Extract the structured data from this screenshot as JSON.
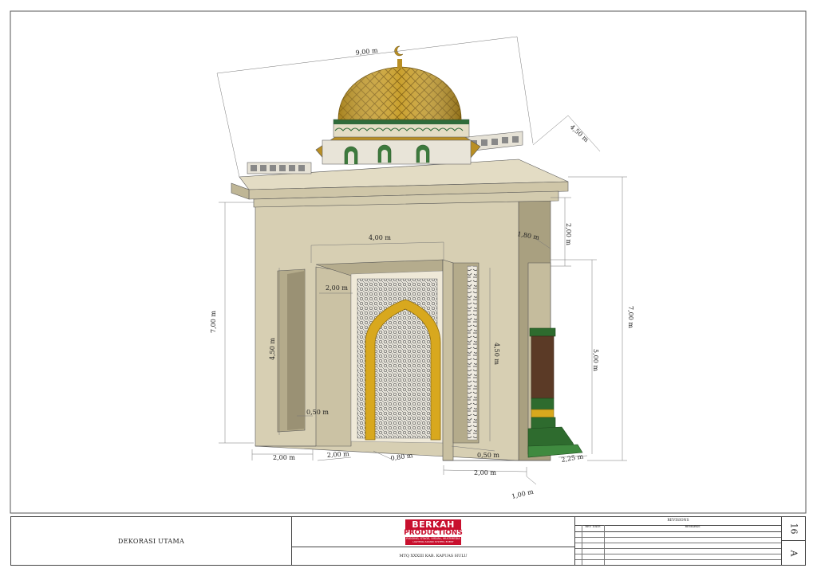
{
  "drawing": {
    "dimensions": {
      "total_width": "9,00 m",
      "depth_top": "4,50 m",
      "inner_span": "4,00 m",
      "total_height_left": "7,00 m",
      "total_height_right": "7,00 m",
      "top_band": "2,00 m",
      "top_offset": "1,80 m",
      "opening_height_left": "4,50 m",
      "opening_height_right": "4,50 m",
      "post_height": "5,00 m",
      "inner_panel_width": "2,00 m",
      "wall_left": "0,50 m",
      "wall_right": "0,50 m",
      "base_left": "2,00 m",
      "base_inner": "2,00 m",
      "base_gap": "0,80 m",
      "base_right": "2,00 m",
      "base_depth": "1,00 m",
      "post_base": "2,25 m"
    },
    "colors": {
      "wall": "#d7cfb3",
      "wall_shade": "#c4bb9c",
      "wall_dark": "#a9a080",
      "dome": "#c9a02e",
      "dome_dark": "#8f6d12",
      "green": "#2e6b2e",
      "gold_arch": "#d8a81e",
      "post": "#5b3a26"
    }
  },
  "titleblock": {
    "drawing_name": "DEKORASI UTAMA",
    "logo_line1": "BERKAH",
    "logo_line2": "PRODUCTIONS",
    "logo_line3": "RIGGING, STAGE, VISUAL, MULTIMEDIA",
    "logo_line4": "LIGHTING SOUND SYSTEM, EVENT",
    "project": "MTQ XXXIII KAB. KAPUAS HULU",
    "revisions_title": "REVISIONS",
    "rev_col1": "REV. DATE",
    "rev_col2": "REMARKS",
    "sheet_number": "16",
    "sheet_size": "A"
  }
}
